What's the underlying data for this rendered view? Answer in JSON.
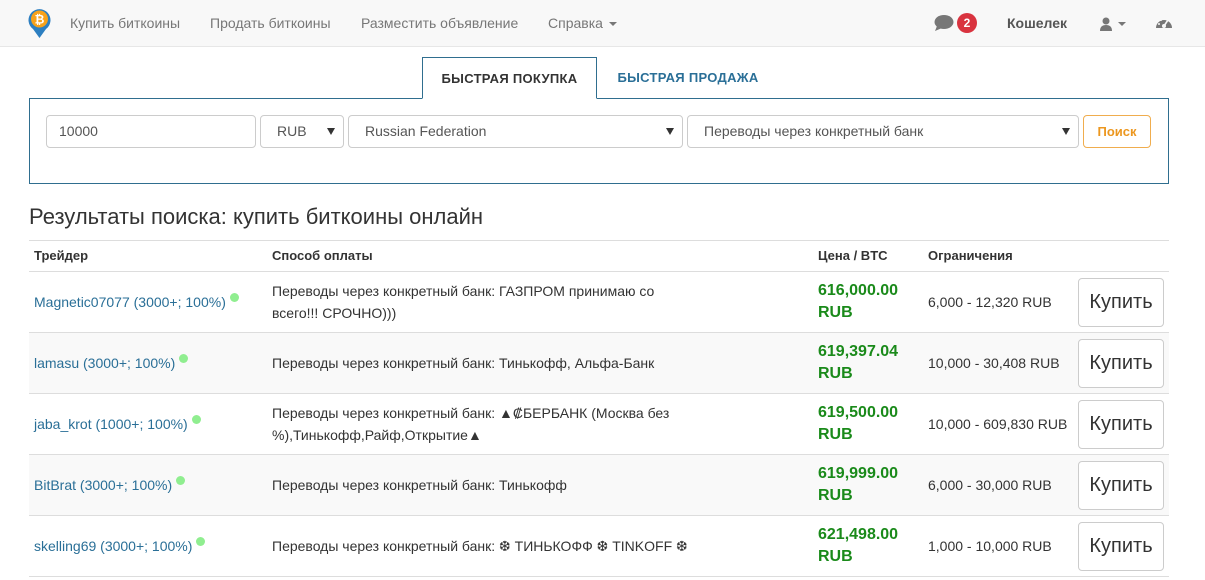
{
  "nav": {
    "buy_bitcoins": "Купить биткоины",
    "sell_bitcoins": "Продать биткоины",
    "post_ad": "Разместить объявление",
    "help": "Справка",
    "messages_count": "2",
    "wallet": "Кошелек",
    "icons": [
      "bitcoin-logo-icon",
      "chat-icon",
      "user-icon",
      "dashboard-icon"
    ]
  },
  "tabs": {
    "quick_buy": "БЫСТРАЯ ПОКУПКА",
    "quick_sell": "БЫСТРАЯ ПРОДАЖА"
  },
  "search": {
    "amount": "10000",
    "currency": "RUB",
    "country": "Russian Federation",
    "payment_method": "Переводы через конкретный банк",
    "button": "Поиск"
  },
  "results": {
    "title": "Результаты поиска: купить биткоины онлайн",
    "columns": [
      "Трейдер",
      "Способ оплаты",
      "Цена / BTC",
      "Ограничения"
    ],
    "buy_label": "Купить",
    "rows": [
      {
        "trader": "Magnetic07077 (3000+; 100%)",
        "payment": "Переводы через конкретный банк: ГАЗПРОМ принимаю со всего!!! СРОЧНО)))",
        "price": "616,000.00",
        "currency": "RUB",
        "limits": "6,000 - 12,320 RUB"
      },
      {
        "trader": "lamasu (3000+; 100%)",
        "payment": "Переводы через конкретный банк: Тинькофф, Альфа-Банк",
        "price": "619,397.04",
        "currency": "RUB",
        "limits": "10,000 - 30,408 RUB"
      },
      {
        "trader": "jaba_krot (1000+; 100%)",
        "payment": "Переводы через конкретный банк: ▲₡БЕРБАНК (Москва без %),Тинькофф,Райф,Открытие▲",
        "price": "619,500.00",
        "currency": "RUB",
        "limits": "10,000 - 609,830 RUB"
      },
      {
        "trader": "BitBrat (3000+; 100%)",
        "payment": "Переводы через конкретный банк: Тинькофф",
        "price": "619,999.00",
        "currency": "RUB",
        "limits": "6,000 - 30,000 RUB"
      },
      {
        "trader": "skelling69 (3000+; 100%)",
        "payment": "Переводы через конкретный банк: ❆ ТИНЬКОФФ ❆ TINKOFF ❆",
        "price": "621,498.00",
        "currency": "RUB",
        "limits": "1,000 - 10,000 RUB"
      }
    ]
  },
  "colors": {
    "link": "#2a6f97",
    "price": "#1a8a1a",
    "badge": "#d9333f",
    "search_button": "#ec971f",
    "panel_border": "#2f6e8f"
  }
}
